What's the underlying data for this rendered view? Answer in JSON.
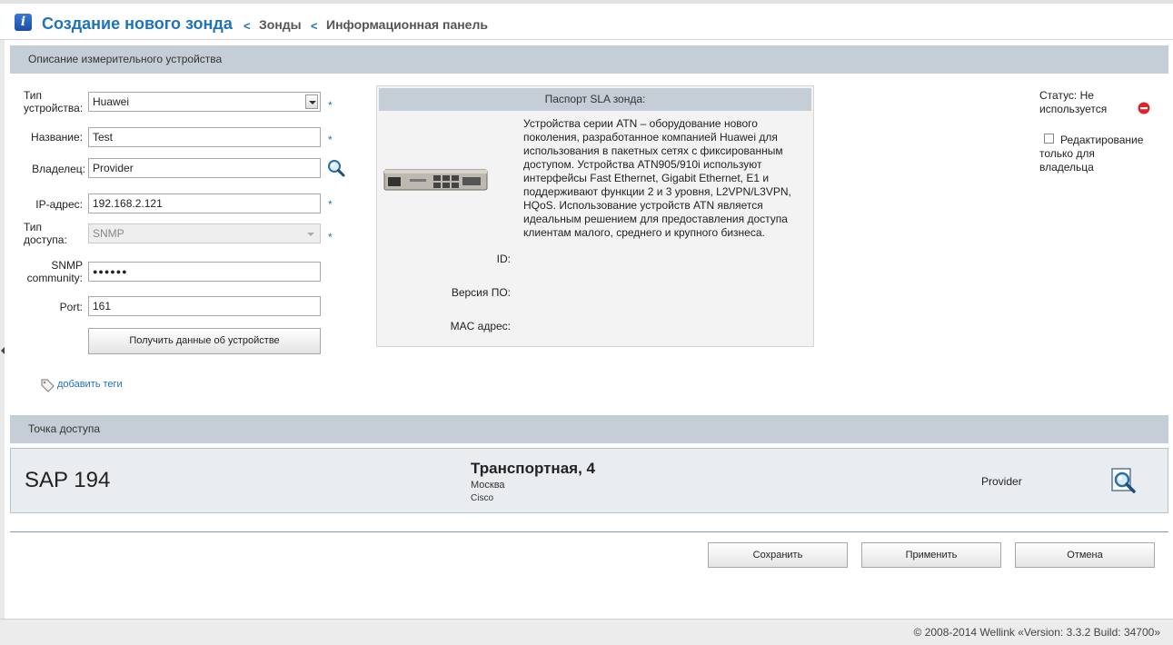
{
  "header": {
    "title": "Создание нового зонда",
    "breadcrumbs": [
      "Зонды",
      "Информационная панель"
    ]
  },
  "device_section": {
    "title": "Описание измерительного устройства",
    "fields": {
      "device_type": {
        "label_line1": "Тип",
        "label_line2": "устройства:",
        "value": "Huawei"
      },
      "name": {
        "label": "Название:",
        "value": "Test"
      },
      "owner": {
        "label": "Владелец:",
        "value": "Provider"
      },
      "ip": {
        "label": "IP-адрес:",
        "value": "192.168.2.121"
      },
      "access_type": {
        "label_line1": "Тип",
        "label_line2": "доступа:",
        "value": "SNMP"
      },
      "snmp": {
        "label_line1": "SNMP",
        "label_line2": "community:",
        "value": "●●●●●●"
      },
      "port": {
        "label": "Port:",
        "value": "161"
      }
    },
    "required_mark": "*",
    "get_device_button": "Получить данные об устройстве",
    "add_tags_link": "добавить теги"
  },
  "sla_passport": {
    "title": "Паспорт SLA зонда:",
    "description": "Устройства серии ATN – оборудование нового поколения, разработанное компанией Huawei для использования в пакетных сетях с фиксированным доступом. Устройства ATN905/910i используют интерфейсы Fast Ethernet, Gigabit Ethernet, E1 и поддерживают функции 2 и 3 уровня, L2VPN/L3VPN, HQoS. Использование устройств ATN является идеальным решением для предоставления доступа клиентам малого, среднего и крупного бизнеса.",
    "id_label": "ID:",
    "firmware_label": "Версия ПО:",
    "mac_label": "MAC адрес:"
  },
  "status": {
    "label_line1": "Статус: Не",
    "label_line2": "используется",
    "edit_owner_line1": "Редактирование",
    "edit_owner_line2": "только для",
    "edit_owner_line3": "владельца",
    "edit_owner_checked": false
  },
  "access_point": {
    "title": "Точка доступа",
    "sap": "SAP 194",
    "address": "Транспортная, 4",
    "city": "Москва",
    "vendor": "Cisco",
    "owner": "Provider"
  },
  "actions": {
    "save": "Сохранить",
    "apply": "Применить",
    "cancel": "Отмена"
  },
  "footer": {
    "text": "© 2008-2014 Wellink «Version: 3.3.2 Build: 34700»"
  },
  "colors": {
    "accent": "#1f73b8",
    "section_header": "#c5ced6",
    "status_icon": "#d8262c"
  }
}
